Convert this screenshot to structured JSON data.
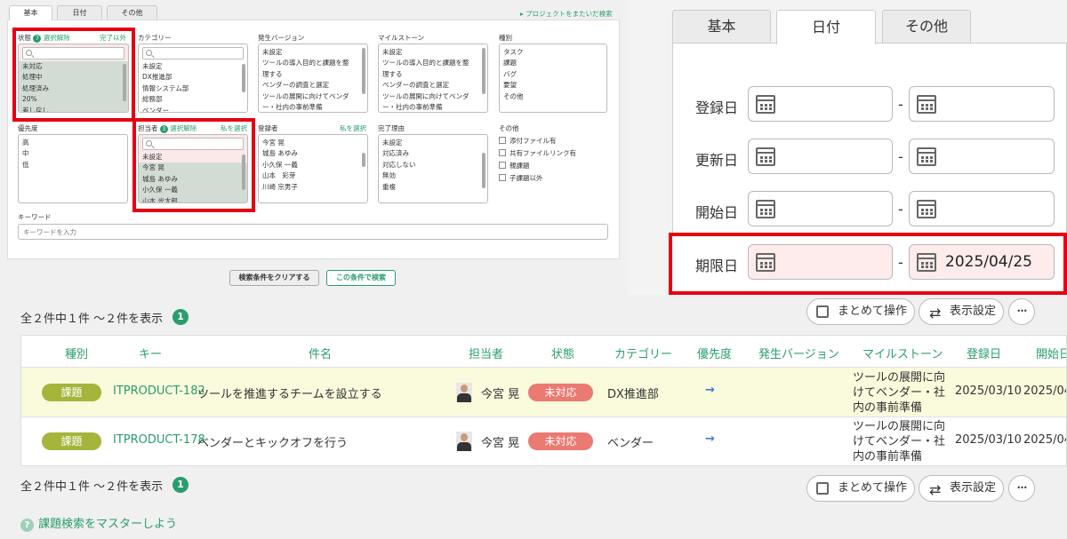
{
  "filter": {
    "tabs": [
      "基本",
      "日付",
      "その他"
    ],
    "cross_project_link": "▸ プロジェクトをまたいだ検索",
    "status": {
      "label": "状態",
      "count": "7",
      "clear": "選択解除",
      "except": "完了以外",
      "options": [
        "未対応",
        "処理中",
        "処理済み",
        "20%",
        "差し戻し"
      ]
    },
    "category": {
      "label": "カテゴリー",
      "options": [
        "未設定",
        "DX推進部",
        "情報システム部",
        "総務部",
        "ベンダー"
      ]
    },
    "version": {
      "label": "発生バージョン",
      "options": [
        "未設定",
        "ツールの導入目的と課題を整",
        "理する",
        "ベンダーの調査と選定",
        "ツールの展開に向けてベンダ",
        "ー・社内の事前準備",
        "効果測定"
      ]
    },
    "milestone": {
      "label": "マイルストーン",
      "options": [
        "未設定",
        "ツールの導入目的と課題を整",
        "理する",
        "ベンダーの調査と選定",
        "ツールの展開に向けてベンダ",
        "ー・社内の事前準備",
        "効果測定"
      ]
    },
    "type": {
      "label": "種別",
      "options": [
        "タスク",
        "課題",
        "バグ",
        "要望",
        "その他"
      ]
    },
    "priority": {
      "label": "優先度",
      "options": [
        "高",
        "中",
        "低"
      ]
    },
    "assignee": {
      "label": "担当者",
      "count": "3",
      "clear": "選択解除",
      "me": "私を選択",
      "options": [
        "未設定",
        "今宮 晃",
        "城島 あゆみ",
        "小久保 一義",
        "山本 光太郎"
      ]
    },
    "registrant": {
      "label": "登録者",
      "me": "私を選択",
      "options": [
        "今宮 晃",
        "城島 あゆみ",
        "小久保 一義",
        "山本　彩芽",
        "川崎 宗男子"
      ]
    },
    "resolution": {
      "label": "完了理由",
      "options": [
        "未設定",
        "対応済み",
        "対応しない",
        "無効",
        "重複"
      ]
    },
    "other": {
      "label": "その他",
      "options": [
        "添付ファイル有",
        "共有ファイルリンク有",
        "親課題",
        "子課題以外"
      ]
    },
    "keyword": {
      "label": "キーワード",
      "placeholder": "キーワードを入力"
    },
    "clear_button": "検索条件をクリアする",
    "search_button": "この条件で検索"
  },
  "date_panel": {
    "tabs": [
      "基本",
      "日付",
      "その他"
    ],
    "rows": [
      {
        "label": "登録日",
        "from": "",
        "to": ""
      },
      {
        "label": "更新日",
        "from": "",
        "to": ""
      },
      {
        "label": "開始日",
        "from": "",
        "to": ""
      },
      {
        "label": "期限日",
        "from": "",
        "to": "2025/04/25"
      }
    ],
    "separator": "-"
  },
  "results": {
    "summary": "全２件中１件 〜２件を表示",
    "page": "1",
    "bulk_button": "まとめて操作",
    "display_button": "表示設定",
    "more": "•••",
    "columns": [
      "種別",
      "キー",
      "件名",
      "担当者",
      "状態",
      "カテゴリー",
      "優先度",
      "発生バージョン",
      "マイルストーン",
      "登録日",
      "開始日"
    ],
    "rows": [
      {
        "type": "課題",
        "key": "ITPRODUCT-182",
        "title": "ツールを推進するチームを設立する",
        "assignee": "今宮 晃",
        "status": "未対応",
        "category": "DX推進部",
        "priority": "→",
        "version": "",
        "milestone": [
          "ツールの展開に向",
          "けてベンダー・社",
          "内の事前準備"
        ],
        "created": "2025/03/10",
        "start": "2025/04"
      },
      {
        "type": "課題",
        "key": "ITPRODUCT-178",
        "title": "ベンダーとキックオフを行う",
        "assignee": "今宮 晃",
        "status": "未対応",
        "category": "ベンダー",
        "priority": "→",
        "version": "",
        "milestone": [
          "ツールの展開に向",
          "けてベンダー・社",
          "内の事前準備"
        ],
        "created": "2025/03/10",
        "start": "2025/04"
      }
    ],
    "help_link": "課題検索をマスターしよう",
    "help_icon": "?"
  },
  "colors": {
    "accent": "#2a9d6c",
    "highlight": "#e60012",
    "status": "#ea7a72",
    "tag": "#a5b43a"
  }
}
